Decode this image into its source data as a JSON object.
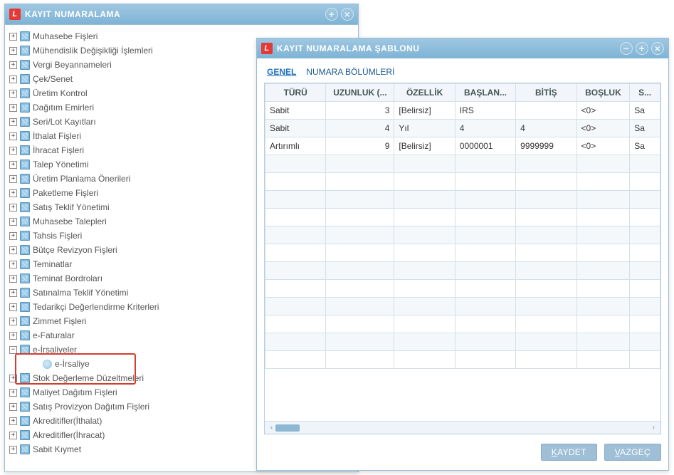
{
  "left_window": {
    "title": "KAYIT NUMARALAMA",
    "tree": [
      {
        "label": "Muhasebe Fişleri",
        "expanded": false
      },
      {
        "label": "Mühendislik Değişikliği İşlemleri",
        "expanded": false
      },
      {
        "label": "Vergi Beyannameleri",
        "expanded": false
      },
      {
        "label": "Çek/Senet",
        "expanded": false
      },
      {
        "label": "Üretim Kontrol",
        "expanded": false
      },
      {
        "label": "Dağıtım Emirleri",
        "expanded": false
      },
      {
        "label": "Seri/Lot Kayıtları",
        "expanded": false
      },
      {
        "label": "İthalat Fişleri",
        "expanded": false
      },
      {
        "label": "İhracat Fişleri",
        "expanded": false
      },
      {
        "label": "Talep Yönetimi",
        "expanded": false
      },
      {
        "label": "Üretim Planlama Önerileri",
        "expanded": false
      },
      {
        "label": "Paketleme Fişleri",
        "expanded": false
      },
      {
        "label": "Satış Teklif Yönetimi",
        "expanded": false
      },
      {
        "label": "Muhasebe Talepleri",
        "expanded": false
      },
      {
        "label": "Tahsis Fişleri",
        "expanded": false
      },
      {
        "label": "Bütçe Revizyon Fişleri",
        "expanded": false
      },
      {
        "label": "Teminatlar",
        "expanded": false
      },
      {
        "label": "Teminat Bordroları",
        "expanded": false
      },
      {
        "label": "Satınalma Teklif Yönetimi",
        "expanded": false
      },
      {
        "label": "Tedarikçi Değerlendirme Kriterleri",
        "expanded": false
      },
      {
        "label": "Zimmet Fişleri",
        "expanded": false
      },
      {
        "label": "e-Faturalar",
        "expanded": false
      },
      {
        "label": "e-İrsaliyeler",
        "expanded": true,
        "children": [
          {
            "label": "e-İrsaliye"
          }
        ]
      },
      {
        "label": "Stok Değerleme Düzeltmeleri",
        "expanded": false
      },
      {
        "label": "Maliyet Dağıtım Fişleri",
        "expanded": false
      },
      {
        "label": "Satış Provizyon Dağıtım Fişleri",
        "expanded": false
      },
      {
        "label": "Akreditifler(İthalat)",
        "expanded": false
      },
      {
        "label": "Akreditifler(İhracat)",
        "expanded": false
      },
      {
        "label": "Sabit Kıymet",
        "expanded": false
      }
    ]
  },
  "right_window": {
    "title": "KAYIT NUMARALAMA ŞABLONU",
    "tabs": [
      {
        "label": "GENEL",
        "active": true
      },
      {
        "label": "NUMARA BÖLÜMLERİ",
        "active": false
      }
    ],
    "grid": {
      "columns": [
        "TÜRÜ",
        "UZUNLUK (...",
        "ÖZELLİK",
        "BAŞLAN...",
        "BİTİŞ",
        "BOŞLUK",
        "S..."
      ],
      "rows": [
        {
          "turu": "Sabit",
          "uzunluk": "3",
          "ozellik": "[Belirsiz]",
          "baslangic": "IRS",
          "bitis": "",
          "bosluk": "<0>",
          "s": "Sa"
        },
        {
          "turu": "Sabit",
          "uzunluk": "4",
          "ozellik": "Yıl",
          "baslangic": "4",
          "bitis": "4",
          "bosluk": "<0>",
          "s": "Sa"
        },
        {
          "turu": "Artırımlı",
          "uzunluk": "9",
          "ozellik": "[Belirsiz]",
          "baslangic": "0000001",
          "bitis": "9999999",
          "bosluk": "<0>",
          "s": "Sa"
        }
      ],
      "empty_rows": 12
    },
    "buttons": {
      "save": "KAYDET",
      "cancel": "VAZGEÇ"
    }
  }
}
